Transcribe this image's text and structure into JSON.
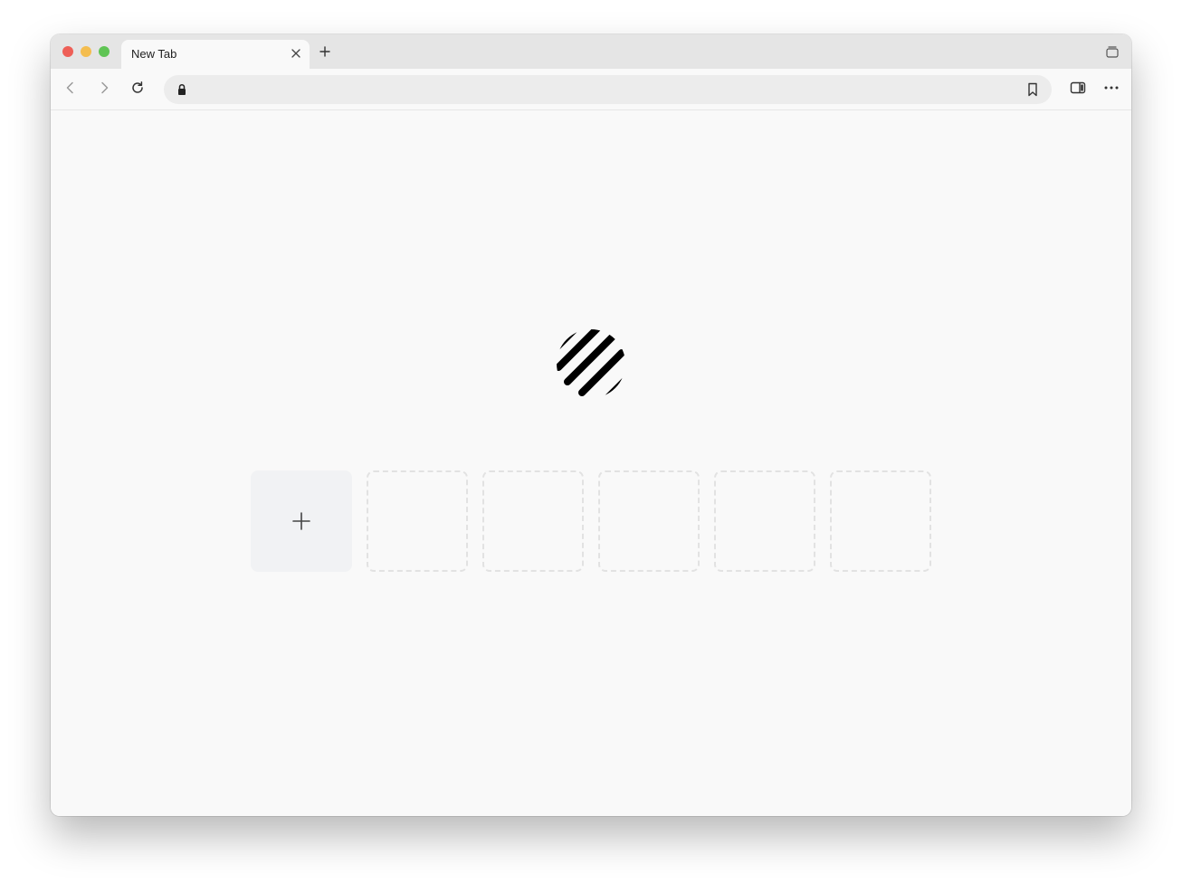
{
  "browser": {
    "tab": {
      "title": "New Tab"
    },
    "address_bar": {
      "value": "",
      "placeholder": ""
    },
    "icons": {
      "window_controls": [
        "close-control",
        "minimize-control",
        "zoom-control"
      ],
      "tab_close": "close-icon",
      "new_tab": "plus-icon",
      "tab_overview": "tab-overview-icon",
      "back": "chevron-left-icon",
      "forward": "chevron-right-icon",
      "reload": "reload-icon",
      "lock": "lock-icon",
      "bookmark": "bookmark-icon",
      "sidebar": "sidebar-icon",
      "menu": "more-dots-icon"
    }
  },
  "new_tab_page": {
    "logo": "striped-circle-logo",
    "shortcut_tiles": [
      {
        "kind": "add",
        "icon": "plus-icon"
      },
      {
        "kind": "empty"
      },
      {
        "kind": "empty"
      },
      {
        "kind": "empty"
      },
      {
        "kind": "empty"
      },
      {
        "kind": "empty"
      }
    ]
  },
  "colors": {
    "traffic_red": "#ee5f57",
    "traffic_yellow": "#f4bd4f",
    "traffic_green": "#5fc454",
    "page_background": "#f9f9f9",
    "tabstrip_background": "#e5e5e5",
    "add_tile_background": "#f1f2f4",
    "empty_tile_border": "#e2e2e2"
  }
}
